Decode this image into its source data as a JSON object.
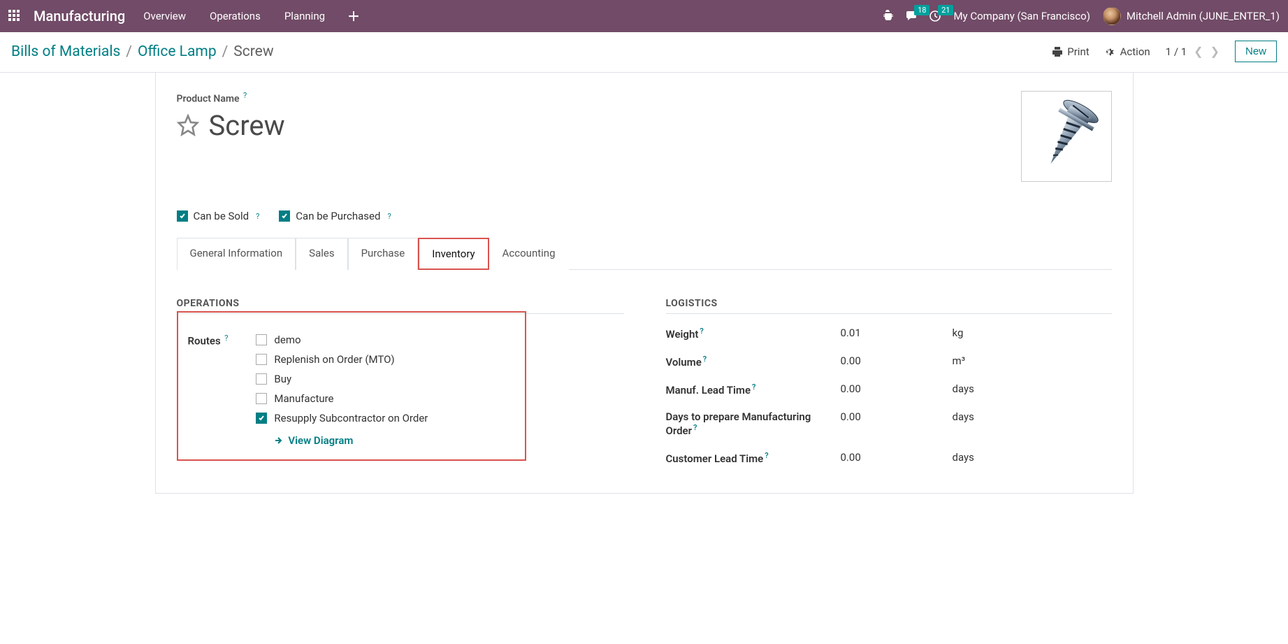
{
  "navbar": {
    "brand": "Manufacturing",
    "links": [
      "Overview",
      "Operations",
      "Planning"
    ],
    "msg_badge": "18",
    "activity_badge": "21",
    "company": "My Company (San Francisco)",
    "username": "Mitchell Admin (JUNE_ENTER_1)"
  },
  "breadcrumbs": {
    "items": [
      "Bills of Materials",
      "Office Lamp"
    ],
    "current": "Screw"
  },
  "cp": {
    "print": "Print",
    "action": "Action",
    "pager": "1 / 1",
    "new": "New"
  },
  "form": {
    "product_label": "Product Name",
    "product_name": "Screw",
    "can_be_sold": "Can be Sold",
    "can_be_purchased": "Can be Purchased"
  },
  "tabs": [
    "General Information",
    "Sales",
    "Purchase",
    "Inventory",
    "Accounting"
  ],
  "operations": {
    "title": "OPERATIONS",
    "routes_label": "Routes",
    "routes": [
      {
        "label": "demo",
        "checked": false
      },
      {
        "label": "Replenish on Order (MTO)",
        "checked": false
      },
      {
        "label": "Buy",
        "checked": false
      },
      {
        "label": "Manufacture",
        "checked": false
      },
      {
        "label": "Resupply Subcontractor on Order",
        "checked": true
      }
    ],
    "view_diagram": "View Diagram"
  },
  "logistics": {
    "title": "LOGISTICS",
    "rows": [
      {
        "label": "Weight",
        "value": "0.01",
        "unit": "kg",
        "help": true
      },
      {
        "label": "Volume",
        "value": "0.00",
        "unit": "m³",
        "help": true
      },
      {
        "label": "Manuf. Lead Time",
        "value": "0.00",
        "unit": "days",
        "help": true
      },
      {
        "label": "Days to prepare Manufacturing Order",
        "value": "0.00",
        "unit": "days",
        "help": true
      },
      {
        "label": "Customer Lead Time",
        "value": "0.00",
        "unit": "days",
        "help": true
      }
    ]
  }
}
